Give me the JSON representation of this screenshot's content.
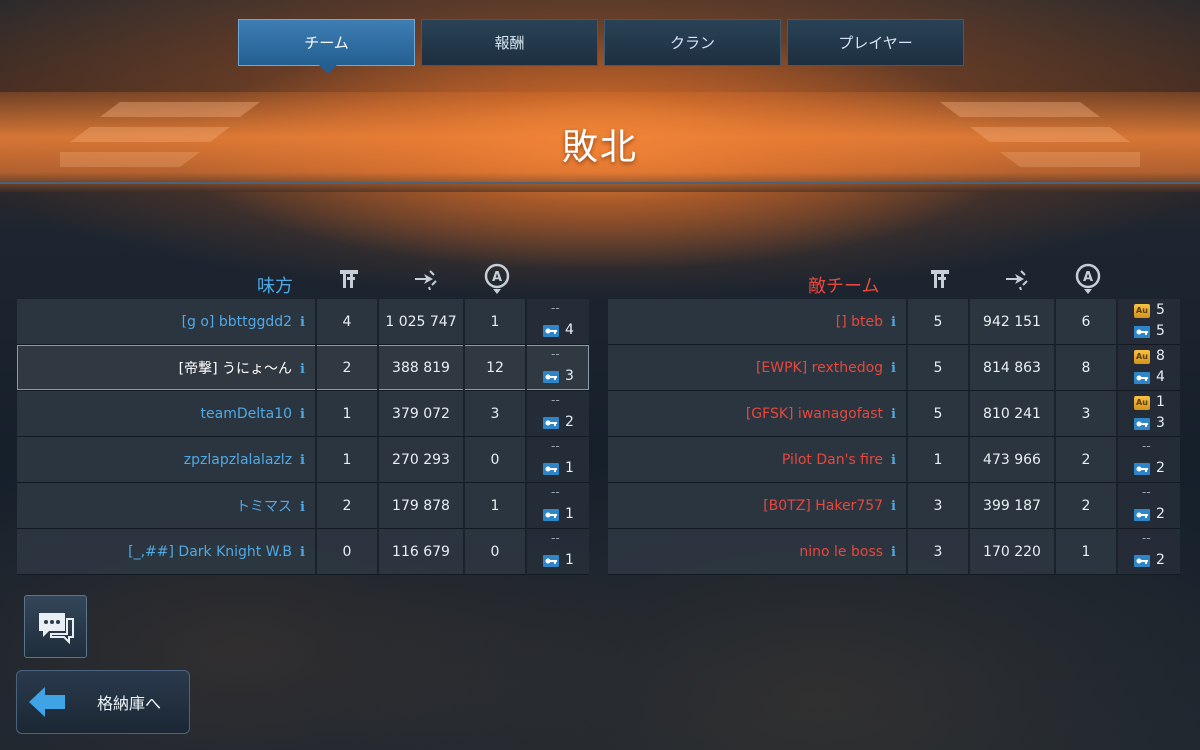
{
  "tabs": [
    {
      "label": "チーム",
      "active": true
    },
    {
      "label": "報酬",
      "active": false
    },
    {
      "label": "クラン",
      "active": false
    },
    {
      "label": "プレイヤー",
      "active": false
    }
  ],
  "result": "敗北",
  "ally": {
    "label": "味方",
    "players": [
      {
        "name": "[g o] bbttggdd2",
        "c1": "4",
        "c2": "1 025 747",
        "c3": "1",
        "au": "--",
        "keys": "4",
        "self": false
      },
      {
        "name": "[帝撃] うにょ〜ん",
        "c1": "2",
        "c2": "388 819",
        "c3": "12",
        "au": "--",
        "keys": "3",
        "self": true
      },
      {
        "name": "teamDelta10",
        "c1": "1",
        "c2": "379 072",
        "c3": "3",
        "au": "--",
        "keys": "2",
        "self": false
      },
      {
        "name": "zpzlapzlalalazlz",
        "c1": "1",
        "c2": "270 293",
        "c3": "0",
        "au": "--",
        "keys": "1",
        "self": false
      },
      {
        "name": "トミマス",
        "c1": "2",
        "c2": "179 878",
        "c3": "1",
        "au": "--",
        "keys": "1",
        "self": false
      },
      {
        "name": "[_,##] Dark Knight W.B",
        "c1": "0",
        "c2": "116 679",
        "c3": "0",
        "au": "--",
        "keys": "1",
        "self": false
      }
    ]
  },
  "enemy": {
    "label": "敵チーム",
    "players": [
      {
        "name": "[] bteb",
        "c1": "5",
        "c2": "942 151",
        "c3": "6",
        "au": "5",
        "keys": "5"
      },
      {
        "name": "[EWPK] rexthedog",
        "c1": "5",
        "c2": "814 863",
        "c3": "8",
        "au": "8",
        "keys": "4"
      },
      {
        "name": "[GFSK] iwanagofast",
        "c1": "5",
        "c2": "810 241",
        "c3": "3",
        "au": "1",
        "keys": "3"
      },
      {
        "name": "Pilot Dan's fire",
        "c1": "1",
        "c2": "473 966",
        "c3": "2",
        "au": "--",
        "keys": "2"
      },
      {
        "name": "[B0TZ] Haker757",
        "c1": "3",
        "c2": "399 187",
        "c3": "2",
        "au": "--",
        "keys": "2"
      },
      {
        "name": "nino le boss",
        "c1": "3",
        "c2": "170 220",
        "c3": "1",
        "au": "--",
        "keys": "2"
      }
    ]
  },
  "column_icons": [
    "kills-icon",
    "damage-icon",
    "assists-icon"
  ],
  "au_icon_text": "Au",
  "info_icon_text": "i",
  "hangar_button": "格納庫へ",
  "colors": {
    "ally": "#4fa9e6",
    "enemy": "#e8473d",
    "tab_active": "#2f6da2"
  }
}
